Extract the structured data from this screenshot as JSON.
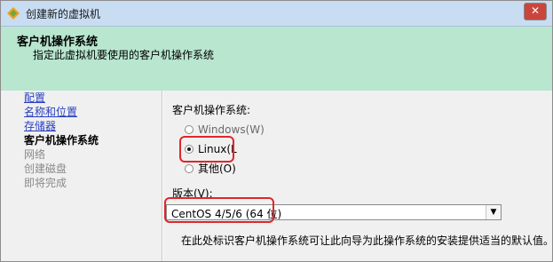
{
  "window": {
    "title": "创建新的虚拟机",
    "close_label": "✕"
  },
  "header": {
    "title": "客户机操作系统",
    "description": "指定此虚拟机要使用的客户机操作系统"
  },
  "sidebar": {
    "items": [
      {
        "label": "配置",
        "state": "link"
      },
      {
        "label": "名称和位置",
        "state": "link"
      },
      {
        "label": "存储器",
        "state": "link"
      },
      {
        "label": "客户机操作系统",
        "state": "current"
      },
      {
        "label": "网络",
        "state": "disabled"
      },
      {
        "label": "创建磁盘",
        "state": "disabled"
      },
      {
        "label": "即将完成",
        "state": "disabled"
      }
    ]
  },
  "guest_os": {
    "label": "客户机操作系统:",
    "options": [
      {
        "label": "Windows(W)",
        "checked": false
      },
      {
        "label": "Linux(L",
        "checked": true
      },
      {
        "label": "其他(O)",
        "checked": false
      }
    ]
  },
  "version": {
    "label": "版本(V):",
    "selected": "CentOS 4/5/6 (64 位)",
    "arrow": "▼"
  },
  "hint": "在此处标识客户机操作系统可让此向导为此操作系统的安装提供适当的默认值。",
  "colors": {
    "header_bg": "#b8e6cf",
    "link": "#2a3fbf",
    "highlight": "#e0262b"
  }
}
